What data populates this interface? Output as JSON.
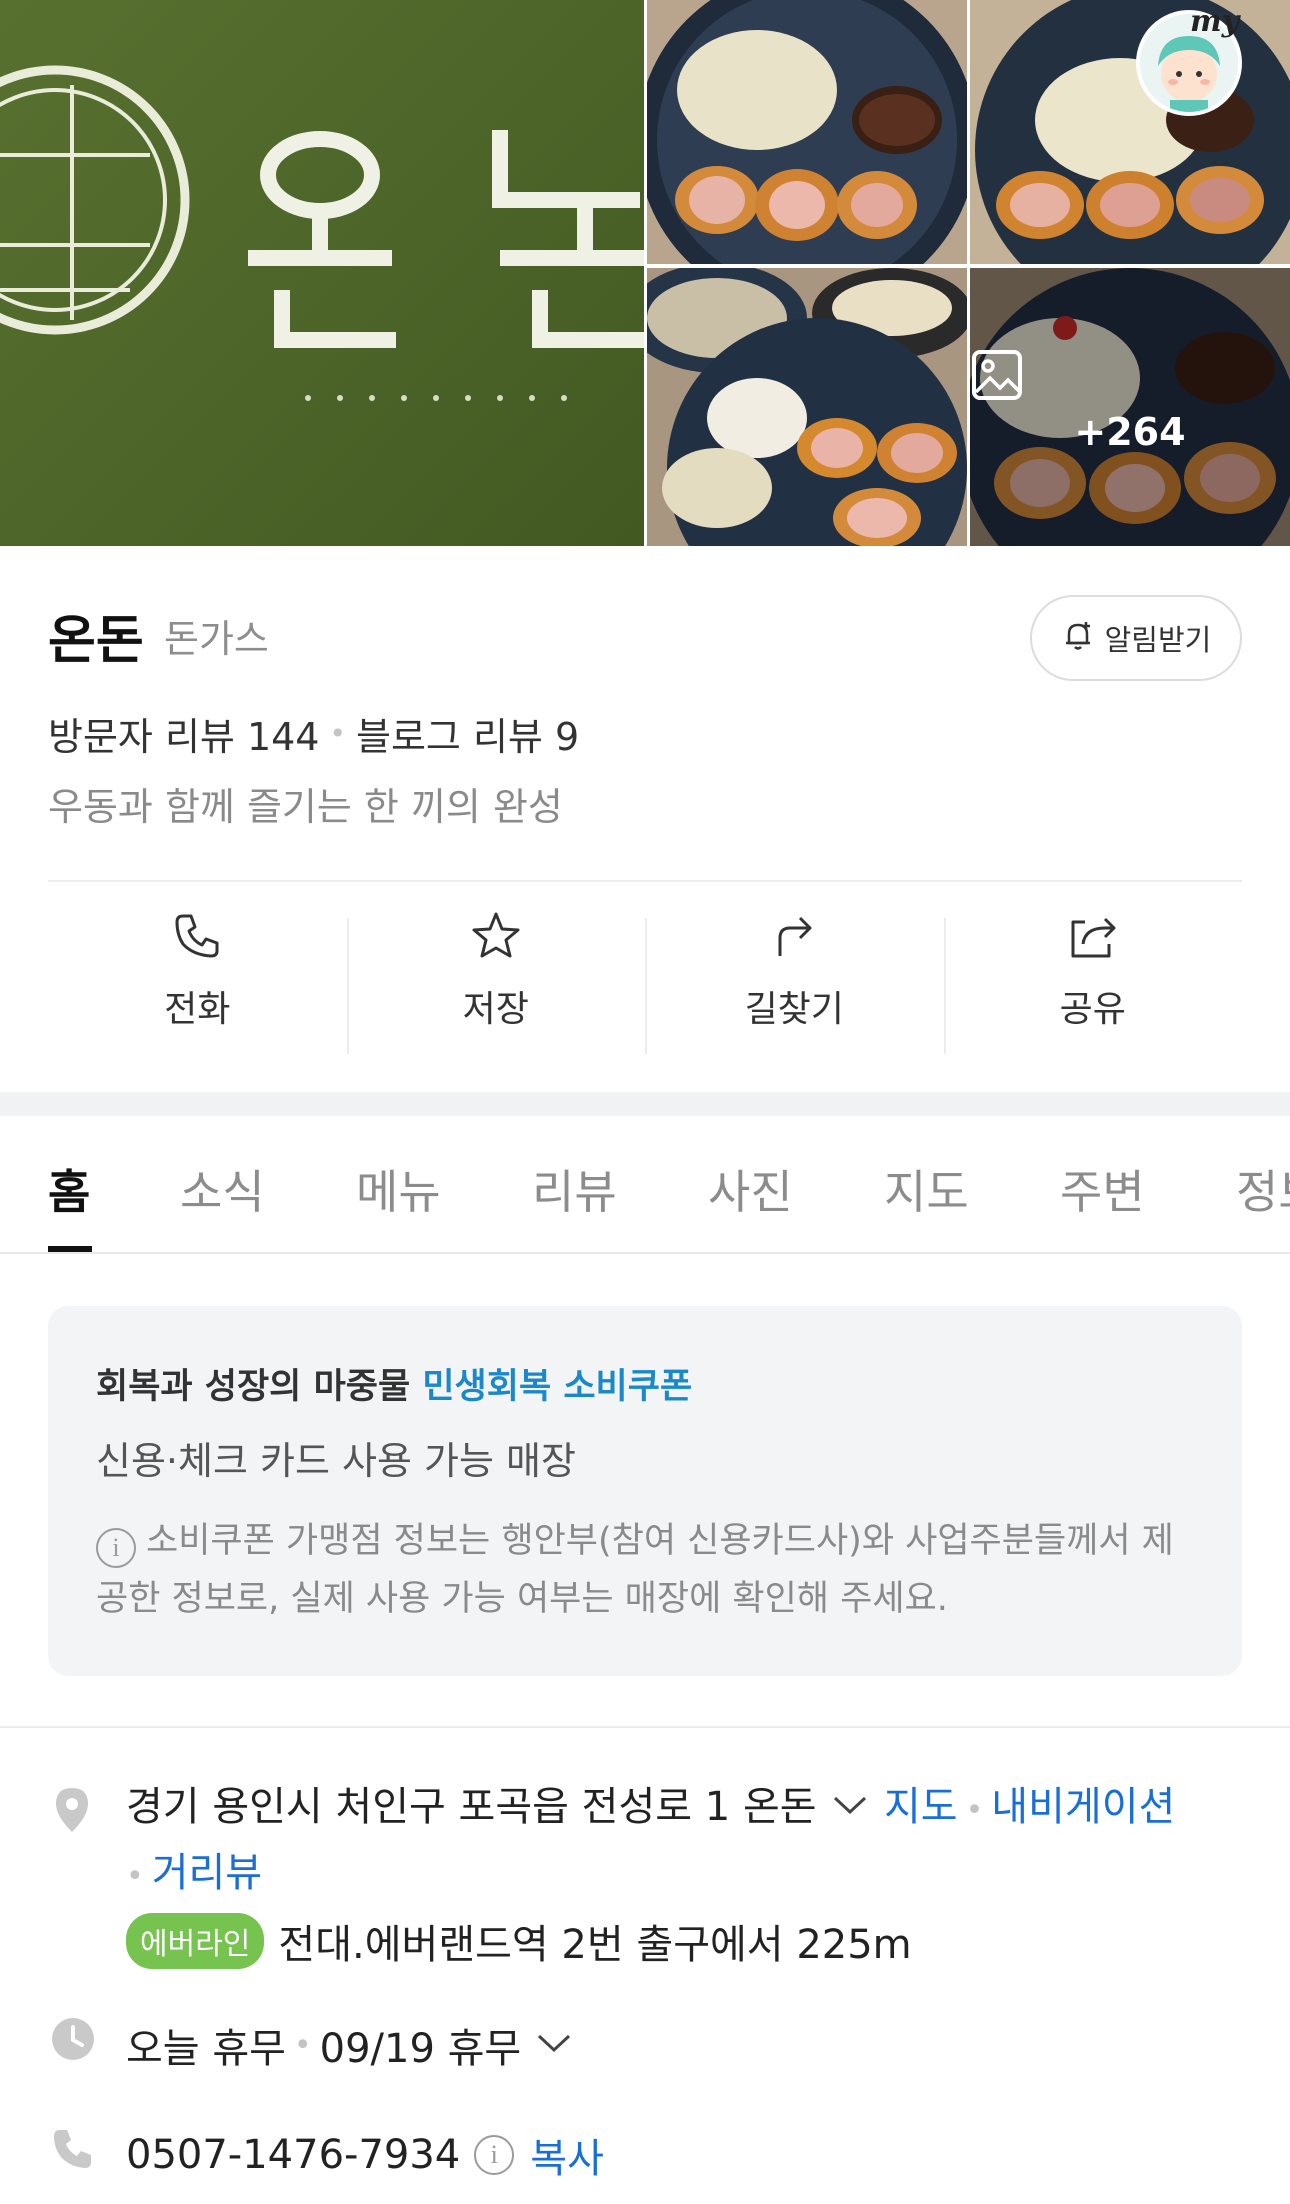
{
  "gallery": {
    "more_photos_count": "+264",
    "my_badge_text": "my"
  },
  "place": {
    "name": "온돈",
    "category": "돈가스",
    "alarm_label": "알림받기",
    "visitor_reviews": "방문자 리뷰 144",
    "blog_reviews": "블로그 리뷰 9",
    "description": "우동과 함께 즐기는 한 끼의 완성"
  },
  "actions": [
    {
      "label": "전화",
      "icon": "phone-icon"
    },
    {
      "label": "저장",
      "icon": "star-icon"
    },
    {
      "label": "길찾기",
      "icon": "directions-icon"
    },
    {
      "label": "공유",
      "icon": "share-icon"
    }
  ],
  "tabs": [
    "홈",
    "소식",
    "메뉴",
    "리뷰",
    "사진",
    "지도",
    "주변",
    "정보"
  ],
  "active_tab": "홈",
  "coupon": {
    "title_prefix": "회복과 성장의 마중물 ",
    "title_highlight": "민생회복 소비쿠폰",
    "subtitle": "신용·체크 카드 사용 가능 매장",
    "notice": "소비쿠폰 가맹점 정보는 행안부(참여 신용카드사)와 사업주분들께서 제공한 정보로, 실제 사용 가능 여부는 매장에 확인해 주세요."
  },
  "info": {
    "address": "경기 용인시 처인구 포곡읍 전성로 1 온돈",
    "map_link": "지도",
    "navigation_link": "내비게이션",
    "street_view_link": "거리뷰",
    "subway_line": "에버라인",
    "subway_directions": "전대.에버랜드역 2번 출구에서 225m",
    "hours_today": "오늘 휴무",
    "hours_next": "09/19 휴무",
    "phone": "0507-1476-7934",
    "copy_label": "복사"
  },
  "colors": {
    "link": "#1a6ed8",
    "highlight": "#1a88c9",
    "subway_badge": "#77c34f",
    "logo_bg": "#4c6428"
  }
}
